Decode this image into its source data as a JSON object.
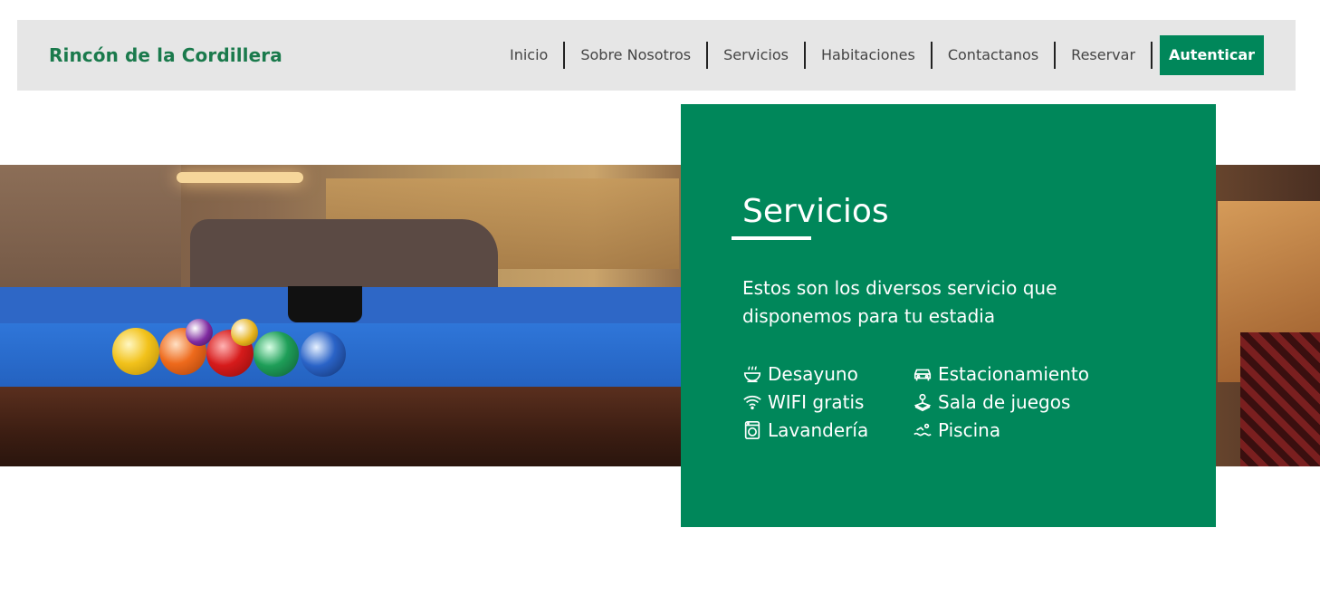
{
  "brand": {
    "name": "Rincón de la Cordillera",
    "color": "#1a7a4c"
  },
  "nav": {
    "items": [
      {
        "label": "Inicio"
      },
      {
        "label": "Sobre Nosotros"
      },
      {
        "label": "Servicios"
      },
      {
        "label": "Habitaciones"
      },
      {
        "label": "Contactanos"
      },
      {
        "label": "Reservar"
      }
    ],
    "auth_label": "Autenticar",
    "accent": "#00875a"
  },
  "panel": {
    "title": "Servicios",
    "description": "Estos son los diversos servicio que disponemos para tu estadia",
    "services": [
      {
        "label": "Desayuno",
        "icon": "breakfast-bowl-icon"
      },
      {
        "label": "Estacionamiento",
        "icon": "car-icon"
      },
      {
        "label": "WIFI gratis",
        "icon": "wifi-icon"
      },
      {
        "label": "Sala de juegos",
        "icon": "joystick-icon"
      },
      {
        "label": "Lavandería",
        "icon": "washing-machine-icon"
      },
      {
        "label": "Piscina",
        "icon": "swimming-icon"
      }
    ]
  }
}
